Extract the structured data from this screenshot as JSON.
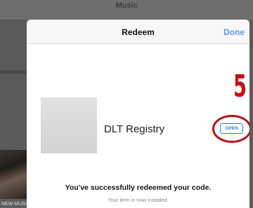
{
  "background": {
    "nav_title": "Music",
    "caption": "NEW MUSIC"
  },
  "sheet": {
    "title": "Redeem",
    "done_label": "Done",
    "app_name": "DLT Registry",
    "open_label": "OPEN",
    "success_message": "You've successfully redeemed your code.",
    "sub_message": "Your item is now installed."
  },
  "annotation": {
    "step_number": "5",
    "color": "#c80f14"
  },
  "colors": {
    "accent": "#2e7be0",
    "done": "#5a9be3"
  }
}
